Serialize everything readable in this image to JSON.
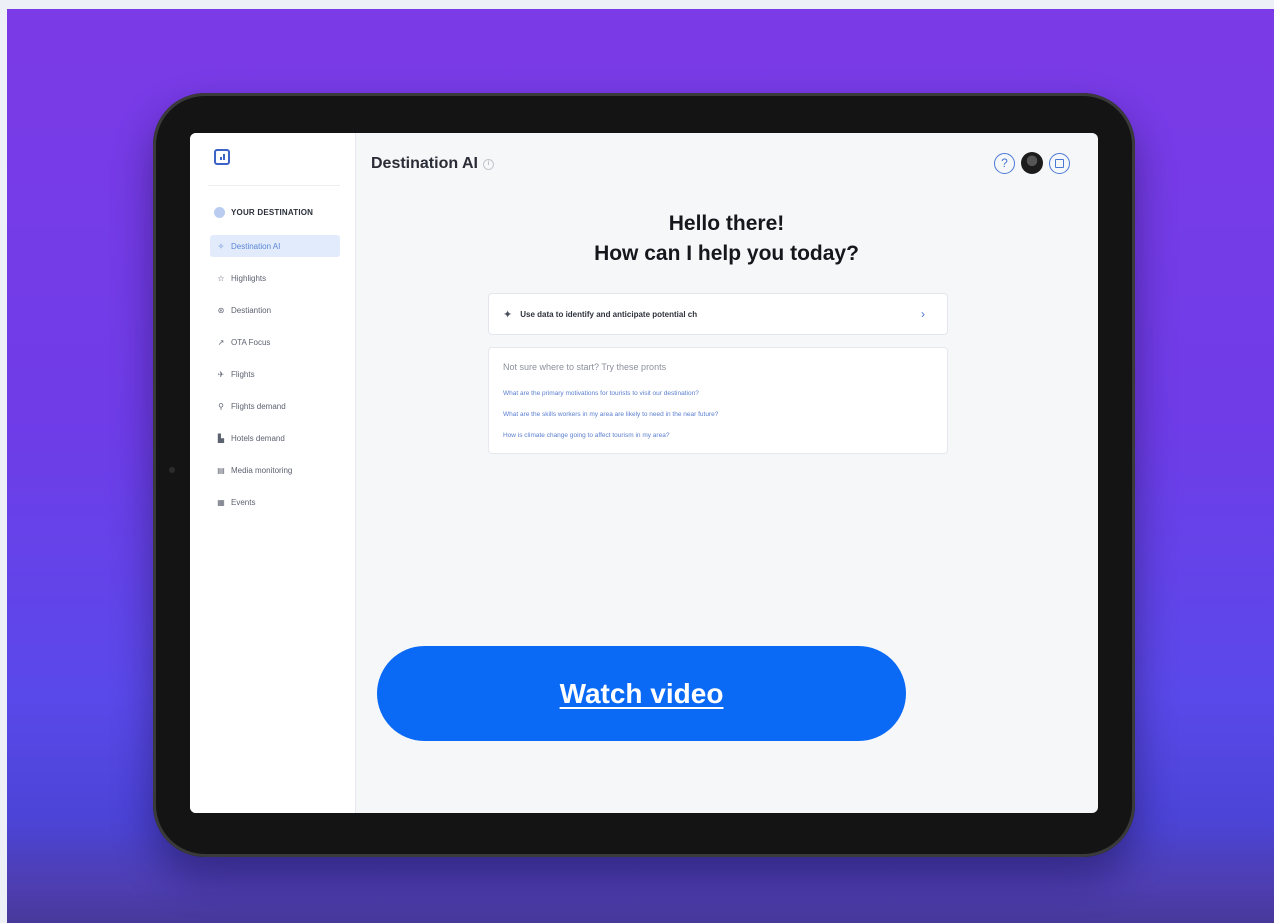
{
  "app": {
    "title": "Destination AI"
  },
  "sidebar": {
    "section_label": "YOUR DESTINATION",
    "items": [
      {
        "label": "Destination AI",
        "icon": "sparkle-icon",
        "glyph": "✧",
        "active": true
      },
      {
        "label": "Highlights",
        "icon": "star-icon",
        "glyph": "☆",
        "active": false
      },
      {
        "label": "Destiantion",
        "icon": "globe-icon",
        "glyph": "⊛",
        "active": false
      },
      {
        "label": "OTA Focus",
        "icon": "trend-icon",
        "glyph": "↗",
        "active": false
      },
      {
        "label": "Flights",
        "icon": "plane-icon",
        "glyph": "✈",
        "active": false
      },
      {
        "label": "Flights demand",
        "icon": "pin-icon",
        "glyph": "⚲",
        "active": false
      },
      {
        "label": "Hotels demand",
        "icon": "bed-icon",
        "glyph": "▙",
        "active": false
      },
      {
        "label": "Media monitoring",
        "icon": "news-icon",
        "glyph": "▤",
        "active": false
      },
      {
        "label": "Events",
        "icon": "calendar-icon",
        "glyph": "▦",
        "active": false
      }
    ]
  },
  "main": {
    "greeting_line1": "Hello there!",
    "greeting_line2": "How can I help you today?",
    "prompt_input_value": "Use data to identify and anticipate potential ch",
    "suggestions_title": "Not sure where to start? Try these pronts",
    "suggestions": [
      "What are the primary motivations for tourists to visit our destination?",
      "What are the skills workers in my area are likely to need in the near future?",
      "How is climate change going to affect tourism in my area?"
    ]
  },
  "cta": {
    "label": "Watch video"
  },
  "colors": {
    "background_top": "#7b3be6",
    "background_bottom": "#4c44d8",
    "accent": "#4a78d8",
    "cta": "#0a6af5"
  }
}
